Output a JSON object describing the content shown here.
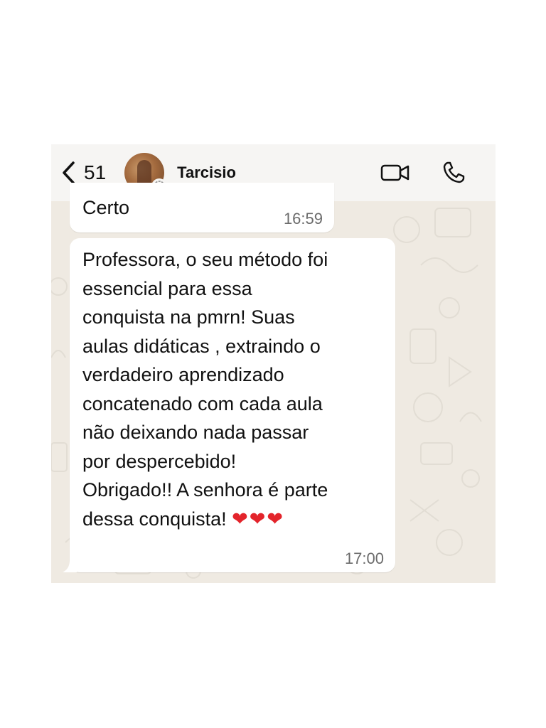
{
  "header": {
    "back_count": "51",
    "contact_name": "Tarcisio",
    "icons": {
      "back": "chevron-left-icon",
      "status_badge": "clock-icon",
      "video": "video-camera-icon",
      "call": "phone-icon"
    }
  },
  "messages": [
    {
      "text": "Certo",
      "time": "16:59"
    },
    {
      "text": "Professora, o seu método foi\nessencial para essa\nconquista na pmrn! Suas\naulas didáticas , extraindo o\nverdadeiro aprendizado\nconcatenado com cada aula\nnão deixando nada passar\npor despercebido!\nObrigado!! A senhora é parte\ndessa conquista! ",
      "hearts": "❤❤❤",
      "time": "17:00"
    }
  ],
  "colors": {
    "chat_background": "#efeae2",
    "header_background": "#f6f5f3",
    "bubble_background": "#ffffff",
    "timestamp": "#6b6b6b",
    "heart": "#e3242b"
  }
}
